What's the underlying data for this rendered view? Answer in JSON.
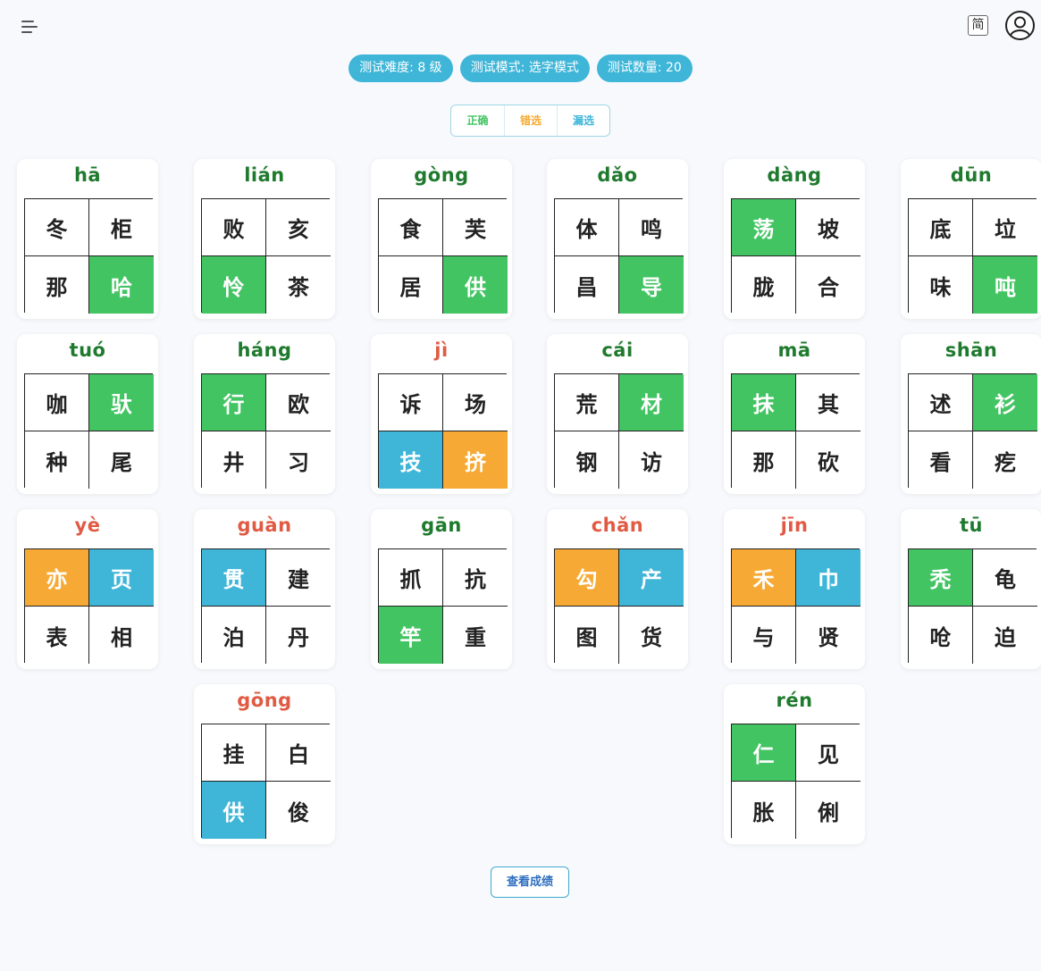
{
  "header": {
    "language_toggle": "简",
    "icons": {
      "menu": "menu-icon",
      "user": "user-avatar-icon"
    }
  },
  "info_pills": [
    "测试难度: 8 级",
    "测试模式: 选字模式",
    "测试数量: 20"
  ],
  "legend": [
    {
      "label": "正确",
      "color": "#43c463"
    },
    {
      "label": "错选",
      "color": "#f6aa35"
    },
    {
      "label": "漏选",
      "color": "#3fb6d8"
    }
  ],
  "questions": [
    {
      "pinyin": "hā",
      "answered_correctly": true,
      "chars": [
        "冬",
        "柜",
        "那",
        "哈"
      ],
      "states": [
        "none",
        "none",
        "none",
        "correct"
      ]
    },
    {
      "pinyin": "lián",
      "answered_correctly": true,
      "chars": [
        "败",
        "亥",
        "怜",
        "茶"
      ],
      "states": [
        "none",
        "none",
        "correct",
        "none"
      ]
    },
    {
      "pinyin": "gòng",
      "answered_correctly": true,
      "chars": [
        "食",
        "芙",
        "居",
        "供"
      ],
      "states": [
        "none",
        "none",
        "none",
        "correct"
      ]
    },
    {
      "pinyin": "dǎo",
      "answered_correctly": true,
      "chars": [
        "体",
        "鸣",
        "昌",
        "导"
      ],
      "states": [
        "none",
        "none",
        "none",
        "correct"
      ]
    },
    {
      "pinyin": "dàng",
      "answered_correctly": true,
      "chars": [
        "荡",
        "坡",
        "胧",
        "合"
      ],
      "states": [
        "correct",
        "none",
        "none",
        "none"
      ]
    },
    {
      "pinyin": "dūn",
      "answered_correctly": true,
      "chars": [
        "底",
        "垃",
        "味",
        "吨"
      ],
      "states": [
        "none",
        "none",
        "none",
        "correct"
      ]
    },
    {
      "pinyin": "tuó",
      "answered_correctly": true,
      "chars": [
        "咖",
        "驮",
        "种",
        "尾"
      ],
      "states": [
        "none",
        "correct",
        "none",
        "none"
      ]
    },
    {
      "pinyin": "háng",
      "answered_correctly": true,
      "chars": [
        "行",
        "欧",
        "井",
        "习"
      ],
      "states": [
        "correct",
        "none",
        "none",
        "none"
      ]
    },
    {
      "pinyin": "jì",
      "answered_correctly": false,
      "chars": [
        "诉",
        "场",
        "技",
        "挤"
      ],
      "states": [
        "none",
        "none",
        "missed",
        "wrong"
      ]
    },
    {
      "pinyin": "cái",
      "answered_correctly": true,
      "chars": [
        "荒",
        "材",
        "钢",
        "访"
      ],
      "states": [
        "none",
        "correct",
        "none",
        "none"
      ]
    },
    {
      "pinyin": "mā",
      "answered_correctly": true,
      "chars": [
        "抹",
        "其",
        "那",
        "砍"
      ],
      "states": [
        "correct",
        "none",
        "none",
        "none"
      ]
    },
    {
      "pinyin": "shān",
      "answered_correctly": true,
      "chars": [
        "述",
        "衫",
        "看",
        "疙"
      ],
      "states": [
        "none",
        "correct",
        "none",
        "none"
      ]
    },
    {
      "pinyin": "yè",
      "answered_correctly": false,
      "chars": [
        "亦",
        "页",
        "表",
        "相"
      ],
      "states": [
        "wrong",
        "missed",
        "none",
        "none"
      ]
    },
    {
      "pinyin": "guàn",
      "answered_correctly": false,
      "chars": [
        "贯",
        "建",
        "泊",
        "丹"
      ],
      "states": [
        "missed",
        "none",
        "none",
        "none"
      ]
    },
    {
      "pinyin": "gān",
      "answered_correctly": true,
      "chars": [
        "抓",
        "抗",
        "竿",
        "重"
      ],
      "states": [
        "none",
        "none",
        "correct",
        "none"
      ]
    },
    {
      "pinyin": "chǎn",
      "answered_correctly": false,
      "chars": [
        "勾",
        "产",
        "图",
        "货"
      ],
      "states": [
        "wrong",
        "missed",
        "none",
        "none"
      ]
    },
    {
      "pinyin": "jīn",
      "answered_correctly": false,
      "chars": [
        "禾",
        "巾",
        "与",
        "贤"
      ],
      "states": [
        "wrong",
        "missed",
        "none",
        "none"
      ]
    },
    {
      "pinyin": "tū",
      "answered_correctly": true,
      "chars": [
        "秃",
        "龟",
        "呛",
        "迫"
      ],
      "states": [
        "correct",
        "none",
        "none",
        "none"
      ]
    },
    {
      "pinyin": "gōng",
      "answered_correctly": false,
      "chars": [
        "挂",
        "白",
        "供",
        "俊"
      ],
      "states": [
        "none",
        "none",
        "missed",
        "none"
      ]
    },
    {
      "pinyin": "rén",
      "answered_correctly": true,
      "chars": [
        "仁",
        "见",
        "胀",
        "俐"
      ],
      "states": [
        "correct",
        "none",
        "none",
        "none"
      ]
    }
  ],
  "footer": {
    "result_button": "查看成绩"
  }
}
